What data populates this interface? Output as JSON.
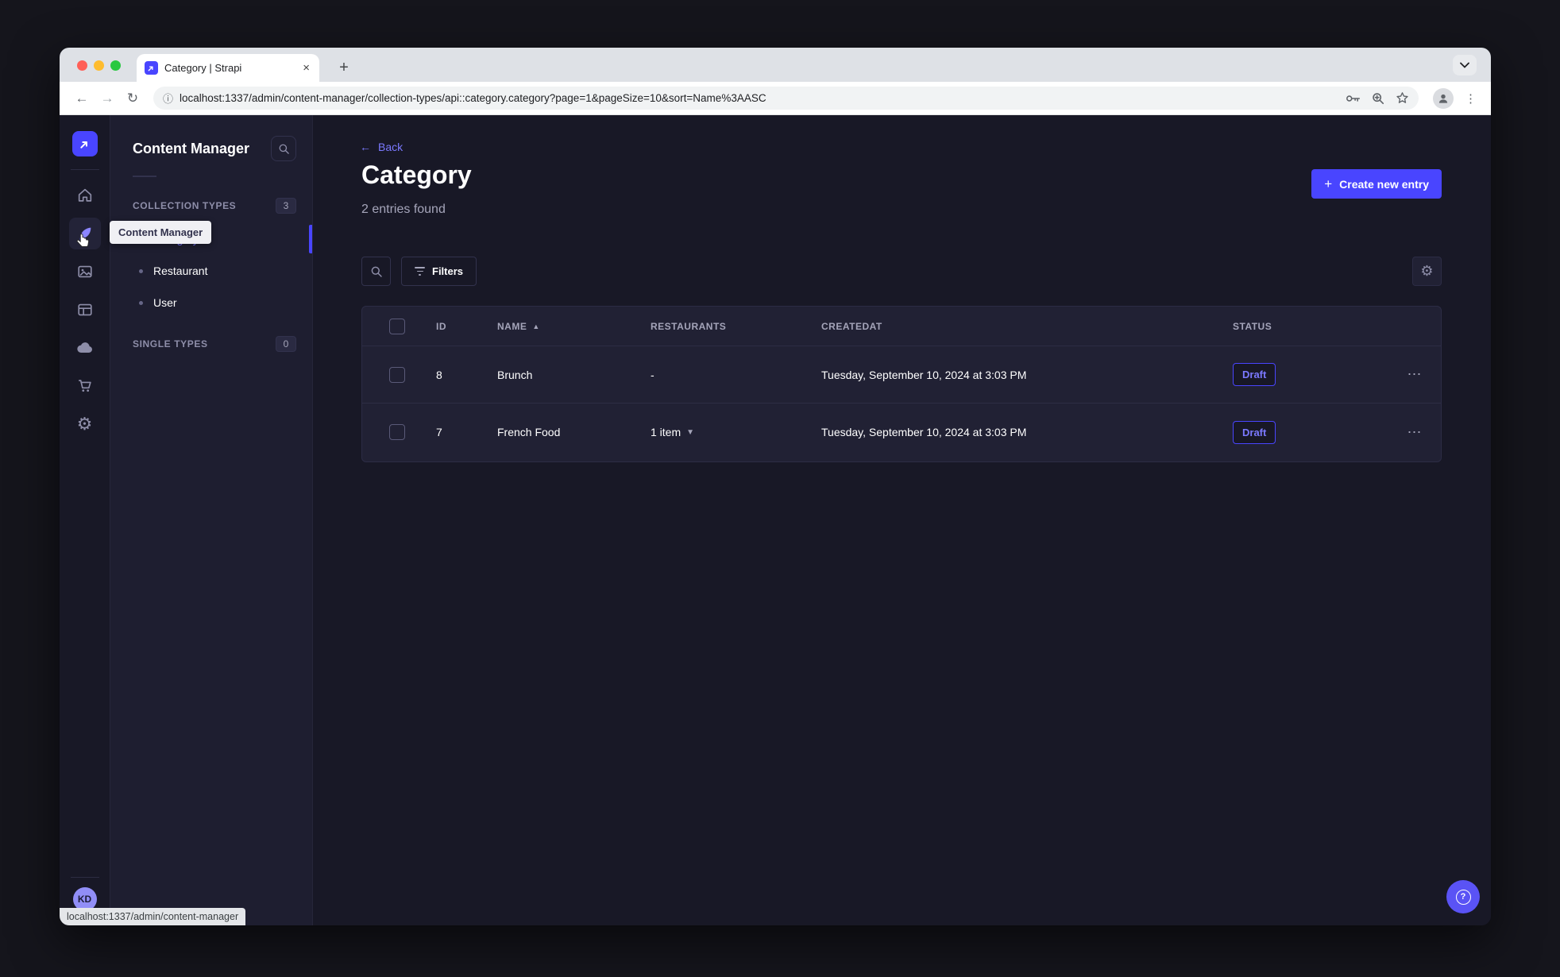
{
  "browser": {
    "tab_title": "Category | Strapi",
    "url": "localhost:1337/admin/content-manager/collection-types/api::category.category?page=1&pageSize=10&sort=Name%3AASC",
    "status_link": "localhost:1337/admin/content-manager"
  },
  "colors": {
    "accent": "#4945ff",
    "accent_light": "#7b79ff",
    "page_bg": "#181826",
    "card_bg": "#212134",
    "border": "#32324d",
    "text_muted": "#a5a5ba"
  },
  "icon_sidebar": {
    "logo_icon": "strapi-logo",
    "items": [
      {
        "name": "home-icon",
        "active": false
      },
      {
        "name": "content-manager-icon",
        "active": true
      },
      {
        "name": "media-library-icon",
        "active": false
      },
      {
        "name": "content-type-builder-icon",
        "active": false
      },
      {
        "name": "cloud-icon",
        "active": false
      },
      {
        "name": "marketplace-icon",
        "active": false
      },
      {
        "name": "settings-icon",
        "active": false
      }
    ],
    "user_initials": "KD"
  },
  "subnav": {
    "title": "Content Manager",
    "tooltip": "Content Manager",
    "sections": [
      {
        "label": "COLLECTION TYPES",
        "count": "3"
      },
      {
        "label": "SINGLE TYPES",
        "count": "0"
      }
    ],
    "items": [
      {
        "label": "Category",
        "active": true
      },
      {
        "label": "Restaurant",
        "active": false
      },
      {
        "label": "User",
        "active": false
      }
    ]
  },
  "main": {
    "back_label": "Back",
    "title": "Category",
    "subtitle": "2 entries found",
    "create_button_label": "Create new entry",
    "filters_button_label": "Filters",
    "table": {
      "columns": [
        "ID",
        "NAME",
        "RESTAURANTS",
        "CREATEDAT",
        "STATUS"
      ],
      "rows": [
        {
          "id": "8",
          "name": "Brunch",
          "restaurants": "-",
          "createdat": "Tuesday, September 10, 2024 at 3:03 PM",
          "status": "Draft"
        },
        {
          "id": "7",
          "name": "French Food",
          "restaurants": "1 item",
          "createdat": "Tuesday, September 10, 2024 at 3:03 PM",
          "status": "Draft"
        }
      ]
    }
  }
}
